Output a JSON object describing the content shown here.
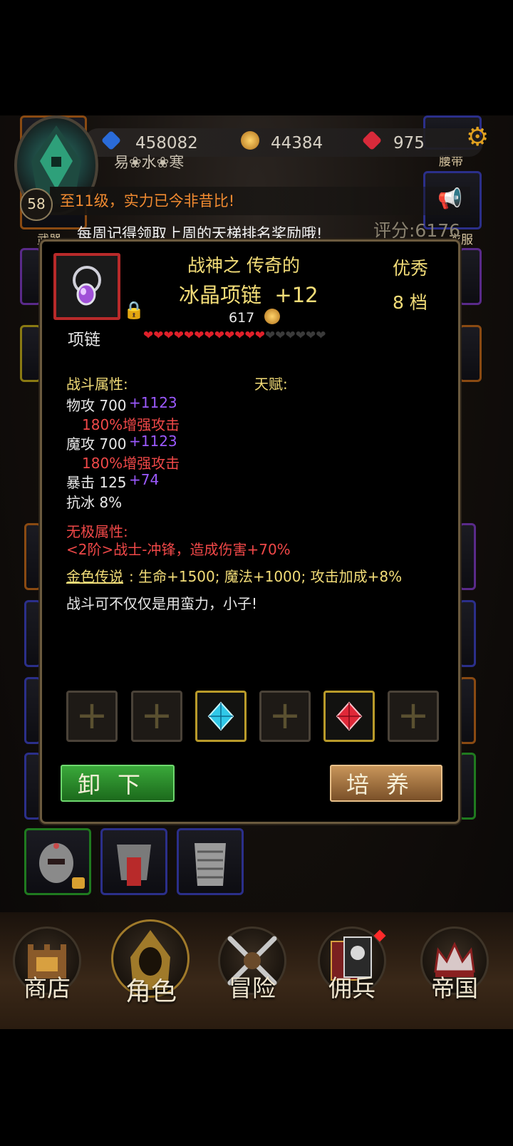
{
  "header": {
    "currencies": [
      {
        "name": "blue-gem",
        "value": "458082",
        "color": "#2a6bd8"
      },
      {
        "name": "gold-coin",
        "value": "44384",
        "color": "#d8a23a"
      },
      {
        "name": "red-gem",
        "value": "975",
        "color": "#d82a3a"
      }
    ],
    "player_name": "易❀水❀寒",
    "level": "58",
    "level_tip": "至11级，实力已今非昔比!",
    "weekly_notice": "每周记得领取上周的天梯排名奖励哦!",
    "score": "评分:6176",
    "settings_icon": "gear-icon"
  },
  "side_labels": {
    "weapon": "武器",
    "belt": "腰带",
    "clothes": "衣服"
  },
  "item": {
    "prefix": "战神之 传奇的",
    "name": "冰晶项链  +12",
    "quality": "优秀",
    "grade": "8 档",
    "price": "617",
    "type": "项链",
    "hearts_filled": 12,
    "hearts_total": 18,
    "icon": "necklace-icon"
  },
  "stats": {
    "combat_title": "战斗属性:",
    "talent_title": "天赋:",
    "lines": [
      {
        "base": "物攻 700",
        "bonus": "+1123"
      },
      {
        "extra": "180%增强攻击"
      },
      {
        "base": "魔攻 700",
        "bonus": "+1123"
      },
      {
        "extra": "180%增强攻击"
      },
      {
        "base": "暴击 125",
        "bonus": "+74"
      },
      {
        "base": "抗冰 8%"
      }
    ],
    "limitless_title": "无极属性:",
    "limitless_value": "<2阶>战士-冲锋，造成伤害+70%",
    "gold_label": "金色传说",
    "gold_value": ": 生命+1500; 魔法+1000; 攻击加成+8%",
    "flavor": "战斗可不仅仅是用蛮力，小子!"
  },
  "sockets": [
    {
      "state": "empty",
      "symbol": "+"
    },
    {
      "state": "empty",
      "symbol": "+"
    },
    {
      "state": "gem",
      "gem": "blue-diamond-gem"
    },
    {
      "state": "empty",
      "symbol": "+"
    },
    {
      "state": "gem",
      "gem": "red-diamond-gem"
    },
    {
      "state": "empty",
      "symbol": "+"
    }
  ],
  "buttons": {
    "unequip": "卸下",
    "cultivate": "培养"
  },
  "nav": [
    {
      "label": "商店",
      "icon": "castle-icon"
    },
    {
      "label": "角色",
      "icon": "hooded-figure-icon"
    },
    {
      "label": "冒险",
      "icon": "crossed-swords-icon"
    },
    {
      "label": "佣兵",
      "icon": "mercenary-cards-icon"
    },
    {
      "label": "帝国",
      "icon": "crown-icon"
    }
  ]
}
